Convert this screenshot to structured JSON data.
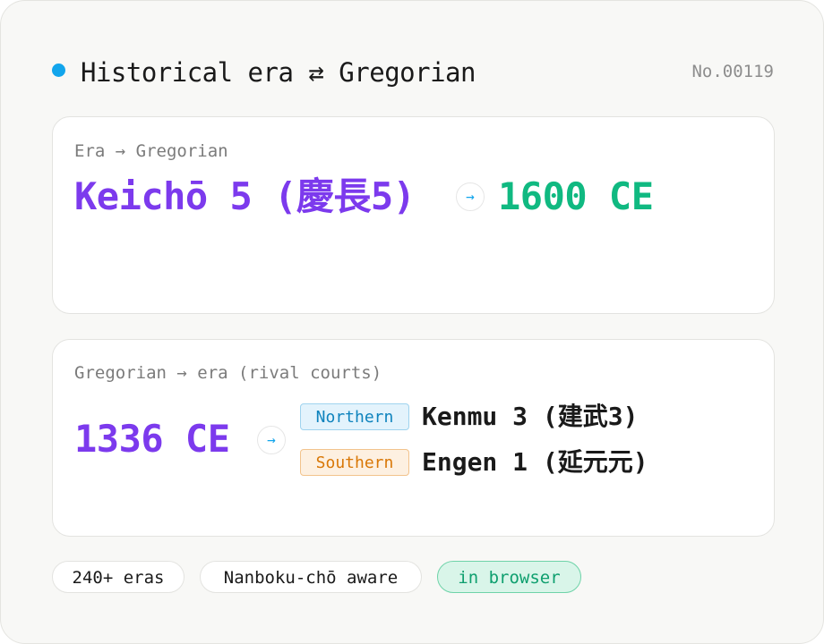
{
  "header": {
    "title": "Historical era ⇄ Gregorian",
    "number": "No.00119",
    "dot_color": "#12a5ec"
  },
  "era_to_gregorian": {
    "label": "Era → Gregorian",
    "era": "Keichō 5 (慶長5)",
    "arrow": "→",
    "gregorian": "1600 CE"
  },
  "gregorian_to_era": {
    "label": "Gregorian → era (rival courts)",
    "gregorian": "1336 CE",
    "arrow": "→",
    "courts": [
      {
        "badge": "Northern",
        "era": "Kenmu 3 (建武3)"
      },
      {
        "badge": "Southern",
        "era": "Engen 1 (延元元)"
      }
    ]
  },
  "tags": [
    "240+ eras",
    "Nanboku-chō aware",
    "in browser"
  ],
  "colors": {
    "accent_purple": "#7c3aed",
    "accent_green": "#10b981",
    "accent_blue": "#12a5ec",
    "northern": "#0e83bd",
    "southern": "#d97706"
  }
}
